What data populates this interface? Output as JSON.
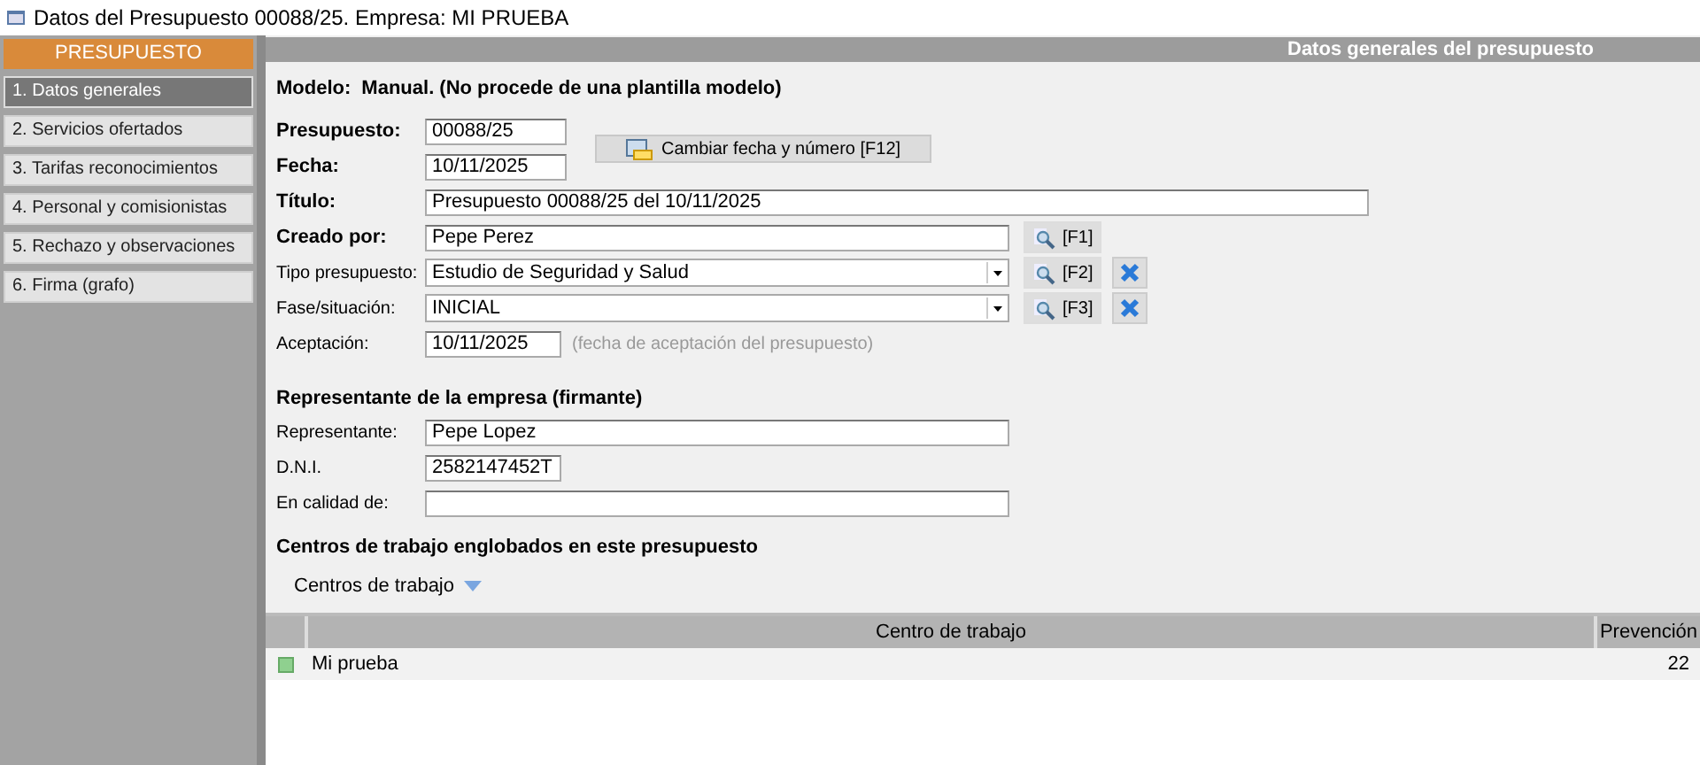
{
  "window": {
    "title": "Datos del Presupuesto 00088/25.  Empresa: MI PRUEBA"
  },
  "sidebar": {
    "header": "PRESUPUESTO",
    "items": [
      {
        "label": "1. Datos generales",
        "selected": true
      },
      {
        "label": "2. Servicios ofertados",
        "selected": false
      },
      {
        "label": "3. Tarifas reconocimientos",
        "selected": false
      },
      {
        "label": "4. Personal y comisionistas",
        "selected": false
      },
      {
        "label": "5. Rechazo y observaciones",
        "selected": false
      },
      {
        "label": "6. Firma (grafo)",
        "selected": false
      }
    ]
  },
  "panel": {
    "title": "Datos generales del presupuesto",
    "modelo": {
      "label": "Modelo:",
      "value": "Manual. (No procede de una plantilla modelo)"
    },
    "presupuesto": {
      "label": "Presupuesto:",
      "value": "00088/25"
    },
    "fecha": {
      "label": "Fecha:",
      "value": "10/11/2025"
    },
    "change_button": "Cambiar fecha y número [F12]",
    "titulo": {
      "label": "Título:",
      "value": "Presupuesto 00088/25 del 10/11/2025"
    },
    "creado_por": {
      "label": "Creado por:",
      "value": "Pepe Perez",
      "lookup": "[F1]"
    },
    "tipo": {
      "label": "Tipo presupuesto:",
      "value": "Estudio de Seguridad y Salud",
      "lookup": "[F2]"
    },
    "fase": {
      "label": "Fase/situación:",
      "value": "INICIAL",
      "lookup": "[F3]"
    },
    "aceptacion": {
      "label": "Aceptación:",
      "value": "10/11/2025",
      "hint": "(fecha de aceptación del presupuesto)"
    },
    "representante_section": "Representante de la empresa (firmante)",
    "representante": {
      "label": "Representante:",
      "value": "Pepe Lopez"
    },
    "dni": {
      "label": "D.N.I.",
      "value": "2582147452T"
    },
    "en_calidad": {
      "label": "En calidad de:"
    },
    "centros_section": "Centros de trabajo englobados en este presupuesto",
    "centros_menu": "Centros de trabajo",
    "table": {
      "columns": [
        "Centro de trabajo",
        "Prevención"
      ],
      "rows": [
        {
          "color": "#8fd08f",
          "cells": [
            "Mi prueba",
            "22"
          ]
        }
      ]
    }
  }
}
